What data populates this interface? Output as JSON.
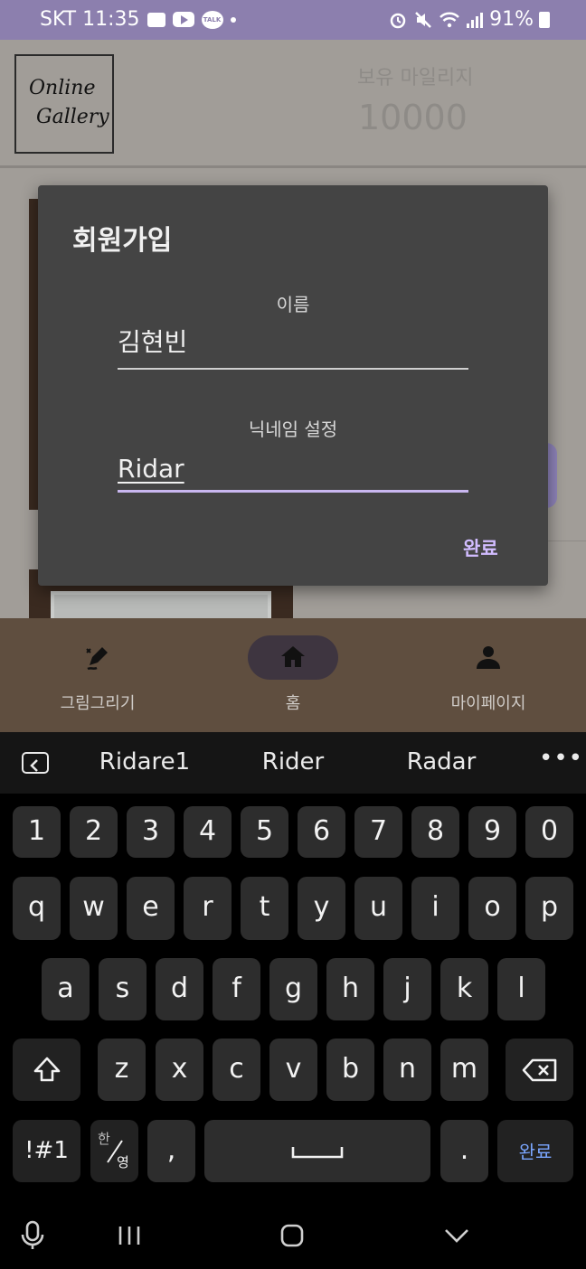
{
  "status_bar": {
    "carrier_time": "SKT 11:35",
    "talk_badge": "TALK",
    "battery": "91%"
  },
  "header": {
    "logo_text_line1": "Online",
    "logo_text_line2": "Gallery",
    "mileage_label": "보유 마일리지",
    "mileage_value": "10000"
  },
  "dialog": {
    "title": "회원가입",
    "name_label": "이름",
    "name_value": "김현빈",
    "nickname_label": "닉네임 설정",
    "nickname_value": "Ridar",
    "confirm_label": "완료"
  },
  "bottom_nav": {
    "items": [
      {
        "label": "그림그리기",
        "icon": "draw-icon"
      },
      {
        "label": "홈",
        "icon": "home-icon",
        "selected": true
      },
      {
        "label": "마이페이지",
        "icon": "person-icon"
      }
    ]
  },
  "keyboard": {
    "suggestions": [
      "Ridare1",
      "Rider",
      "Radar"
    ],
    "row_numbers": [
      "1",
      "2",
      "3",
      "4",
      "5",
      "6",
      "7",
      "8",
      "9",
      "0"
    ],
    "row_1": [
      "q",
      "w",
      "e",
      "r",
      "t",
      "y",
      "u",
      "i",
      "o",
      "p"
    ],
    "row_2": [
      "a",
      "s",
      "d",
      "f",
      "g",
      "h",
      "j",
      "k",
      "l"
    ],
    "row_3": [
      "z",
      "x",
      "c",
      "v",
      "b",
      "n",
      "m"
    ],
    "symbols_label": "!#1",
    "lang_top": "한",
    "lang_bottom": "영",
    "comma": ",",
    "period": ".",
    "done_label": "완료"
  },
  "colors": {
    "status_bar": "#8c7fae",
    "accent": "#d1bcff",
    "nav_bg": "#5f4e3f",
    "dialog_bg": "#444444"
  }
}
